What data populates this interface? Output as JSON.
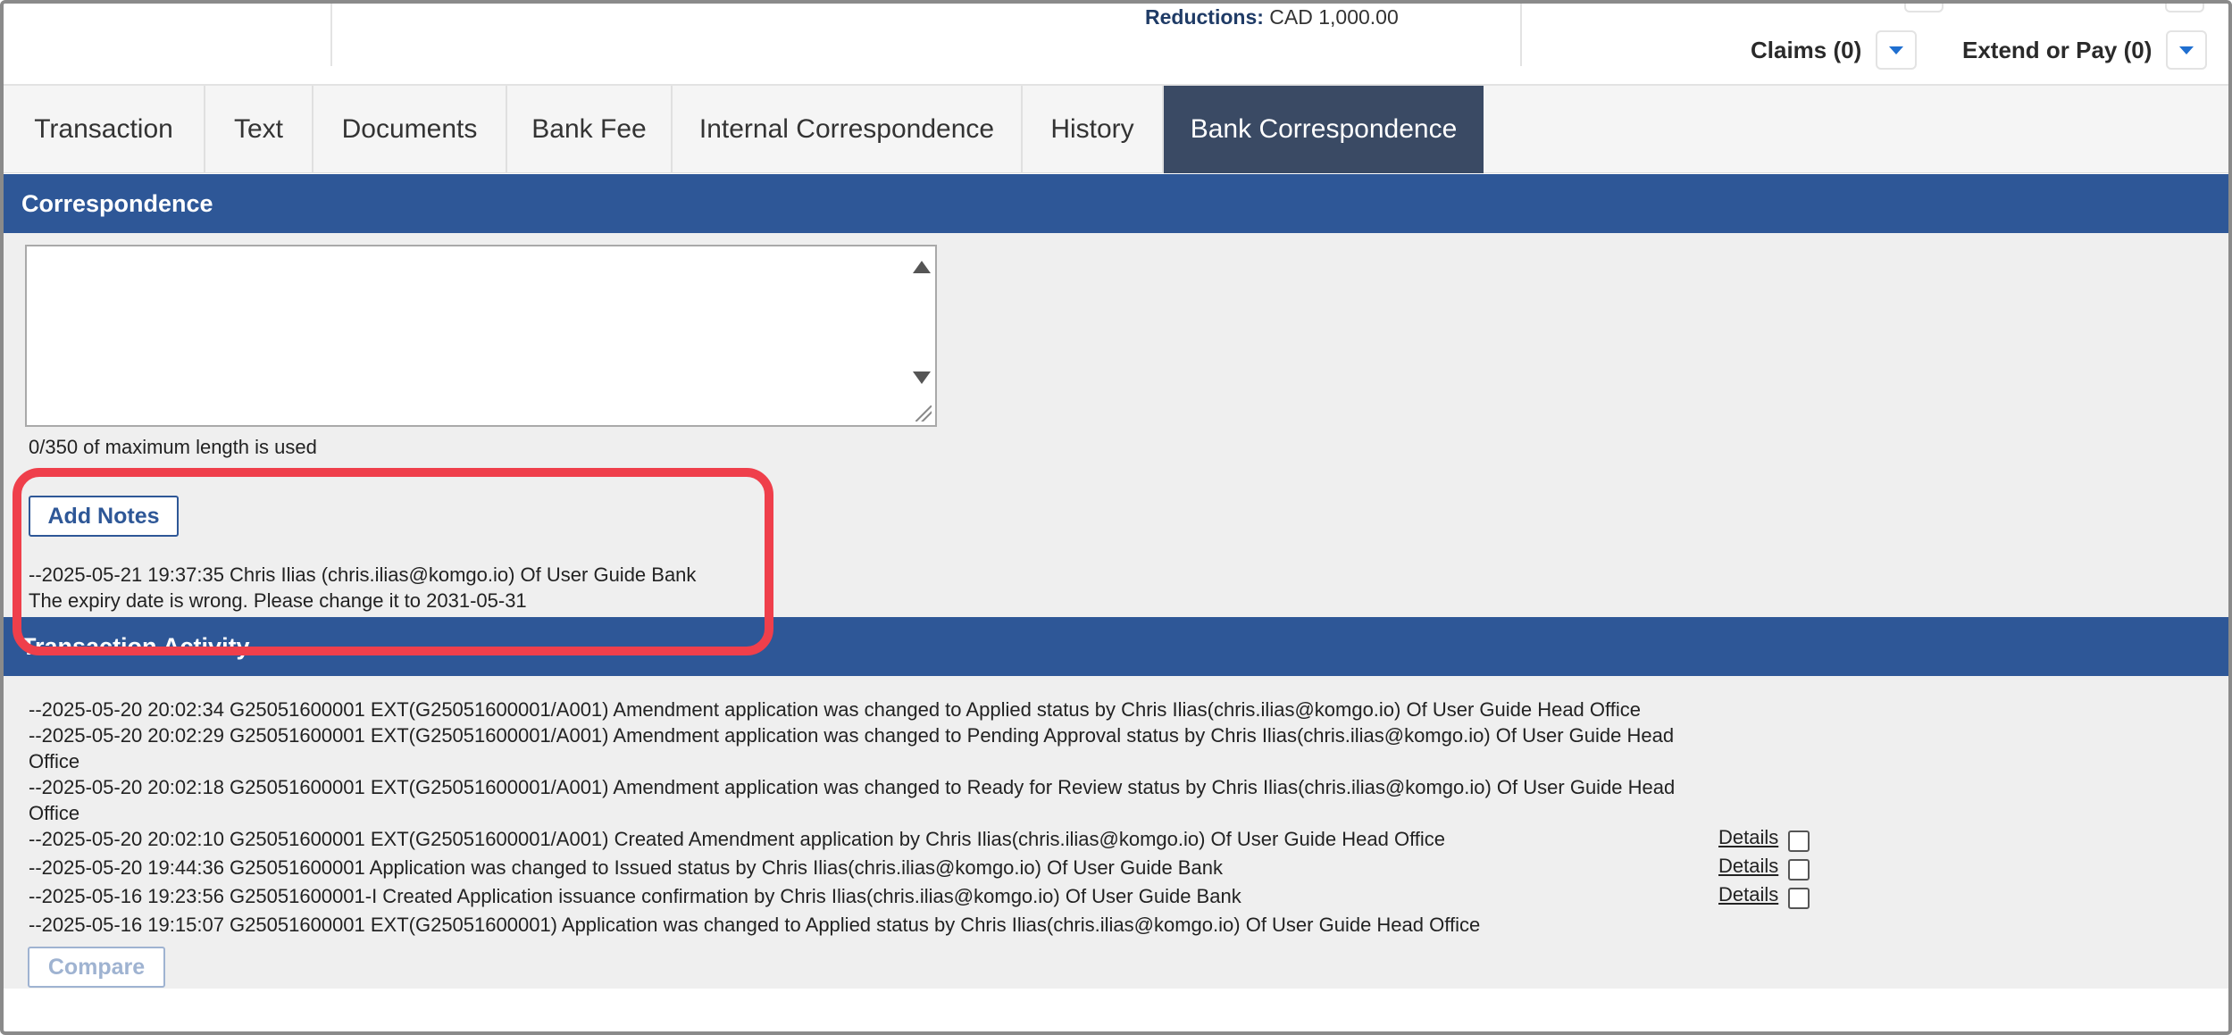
{
  "header": {
    "reductions_label": "Reductions:",
    "reductions_value": "CAD 1,000.00",
    "claims_label": "Claims (0)",
    "extend_label": "Extend or Pay (0)",
    "dropdown_icon": "chevron-down-icon",
    "accent_color": "#1f6fd0"
  },
  "tabs": [
    {
      "label": "Transaction"
    },
    {
      "label": "Text"
    },
    {
      "label": "Documents"
    },
    {
      "label": "Bank Fee"
    },
    {
      "label": "Internal Correspondence"
    },
    {
      "label": "History"
    },
    {
      "label": "Bank Correspondence",
      "active": true
    }
  ],
  "correspondence": {
    "title": "Correspondence",
    "textarea_value": "",
    "counter": "0/350 of maximum length is used",
    "add_notes_label": "Add Notes",
    "notes": [
      {
        "line1": "--2025-05-21 19:37:35 Chris Ilias (chris.ilias@komgo.io) Of User Guide Bank",
        "line2": "The expiry date is wrong. Please change it to 2031-05-31"
      }
    ],
    "section_color": "#2e5797",
    "highlight_color": "#ef3f4b"
  },
  "activity": {
    "title": "Transaction Activity",
    "entries": [
      {
        "text": "--2025-05-20 20:02:34 G25051600001 EXT(G25051600001/A001) Amendment application was changed to Applied status by Chris Ilias(chris.ilias@komgo.io) Of User Guide Head Office"
      },
      {
        "text": "--2025-05-20 20:02:29 G25051600001 EXT(G25051600001/A001) Amendment application was changed to Pending Approval status by Chris Ilias(chris.ilias@komgo.io) Of User Guide Head Office"
      },
      {
        "text": "--2025-05-20 20:02:18 G25051600001 EXT(G25051600001/A001) Amendment application was changed to Ready for Review status by Chris Ilias(chris.ilias@komgo.io) Of User Guide Head Office"
      },
      {
        "text": "--2025-05-20 20:02:10 G25051600001 EXT(G25051600001/A001) Created Amendment application by Chris Ilias(chris.ilias@komgo.io) Of User Guide Head Office",
        "details": "Details"
      },
      {
        "text": "--2025-05-20 19:44:36 G25051600001 Application was changed to Issued status by Chris Ilias(chris.ilias@komgo.io) Of User Guide Bank",
        "details": "Details"
      },
      {
        "text": "--2025-05-16 19:23:56 G25051600001-I Created Application issuance confirmation by Chris Ilias(chris.ilias@komgo.io) Of User Guide Bank",
        "details": "Details"
      },
      {
        "text": "--2025-05-16 19:15:07 G25051600001 EXT(G25051600001) Application was changed to Applied status by Chris Ilias(chris.ilias@komgo.io) Of User Guide Head Office"
      }
    ],
    "compare_label": "Compare"
  }
}
